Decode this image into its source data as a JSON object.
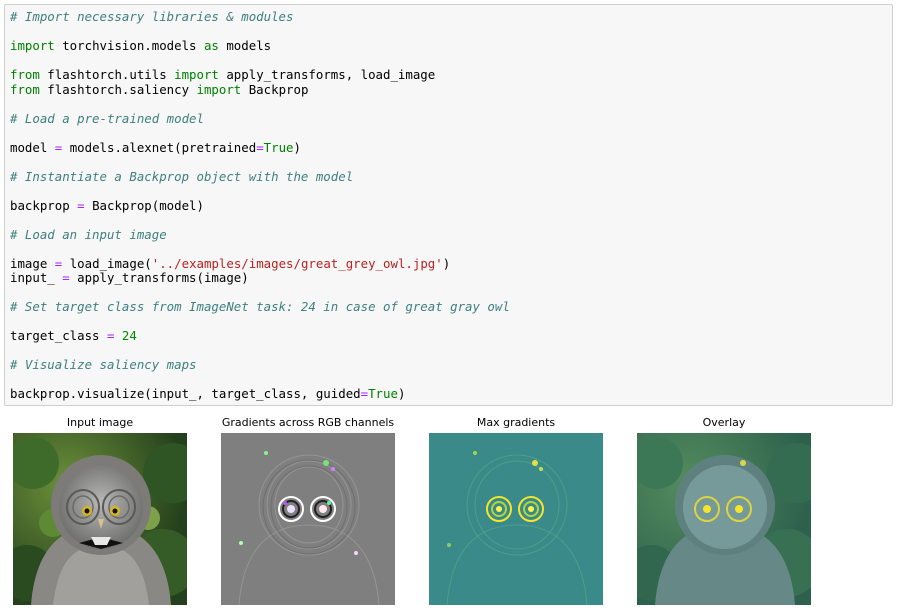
{
  "code_cell": {
    "lines": [
      {
        "t": "comment",
        "text": "# Import necessary libraries & modules"
      },
      {
        "t": "blank"
      },
      {
        "t": "import1",
        "kw1": "import",
        "mod": " torchvision.models ",
        "kw2": "as",
        "alias": " models"
      },
      {
        "t": "blank"
      },
      {
        "t": "from",
        "kw1": "from",
        "mod": " flashtorch.utils ",
        "kw2": "import",
        "rest": " apply_transforms, load_image"
      },
      {
        "t": "from",
        "kw1": "from",
        "mod": " flashtorch.saliency ",
        "kw2": "import",
        "rest": " Backprop"
      },
      {
        "t": "blank"
      },
      {
        "t": "comment",
        "text": "# Load a pre-trained model"
      },
      {
        "t": "blank"
      },
      {
        "t": "assign_true",
        "lhs": "model ",
        "op": "=",
        "rhs": " models.alexnet(pretrained",
        "op2": "=",
        "val": "True",
        "end": ")"
      },
      {
        "t": "blank"
      },
      {
        "t": "comment",
        "text": "# Instantiate a Backprop object with the model"
      },
      {
        "t": "blank"
      },
      {
        "t": "assign",
        "lhs": "backprop ",
        "op": "=",
        "rhs": " Backprop(model)"
      },
      {
        "t": "blank"
      },
      {
        "t": "comment",
        "text": "# Load an input image"
      },
      {
        "t": "blank"
      },
      {
        "t": "assign_str",
        "lhs": "image ",
        "op": "=",
        "rhs": " load_image(",
        "str": "'../examples/images/great_grey_owl.jpg'",
        "end": ")"
      },
      {
        "t": "assign",
        "lhs": "input_ ",
        "op": "=",
        "rhs": " apply_transforms(image)"
      },
      {
        "t": "blank"
      },
      {
        "t": "comment",
        "text": "# Set target class from ImageNet task: 24 in case of great gray owl"
      },
      {
        "t": "blank"
      },
      {
        "t": "assign_num",
        "lhs": "target_class ",
        "op": "=",
        "num": " 24"
      },
      {
        "t": "blank"
      },
      {
        "t": "comment",
        "text": "# Visualize saliency maps"
      },
      {
        "t": "blank"
      },
      {
        "t": "call_true",
        "rhs": "backprop.visualize(input_, target_class, guided",
        "op2": "=",
        "val": "True",
        "end": ")"
      }
    ]
  },
  "figures": [
    {
      "title": "Input image",
      "icon": "owl-photo"
    },
    {
      "title": "Gradients across RGB channels",
      "icon": "rgb-gradients-map"
    },
    {
      "title": "Max gradients",
      "icon": "max-gradients-map"
    },
    {
      "title": "Overlay",
      "icon": "overlay-map"
    }
  ],
  "colors": {
    "comment": "#408080",
    "keyword": "#008000",
    "operator": "#aa22ff",
    "string": "#ba2121",
    "cell_bg": "#f7f7f7",
    "gradient_teal": "#3a8a8a"
  }
}
